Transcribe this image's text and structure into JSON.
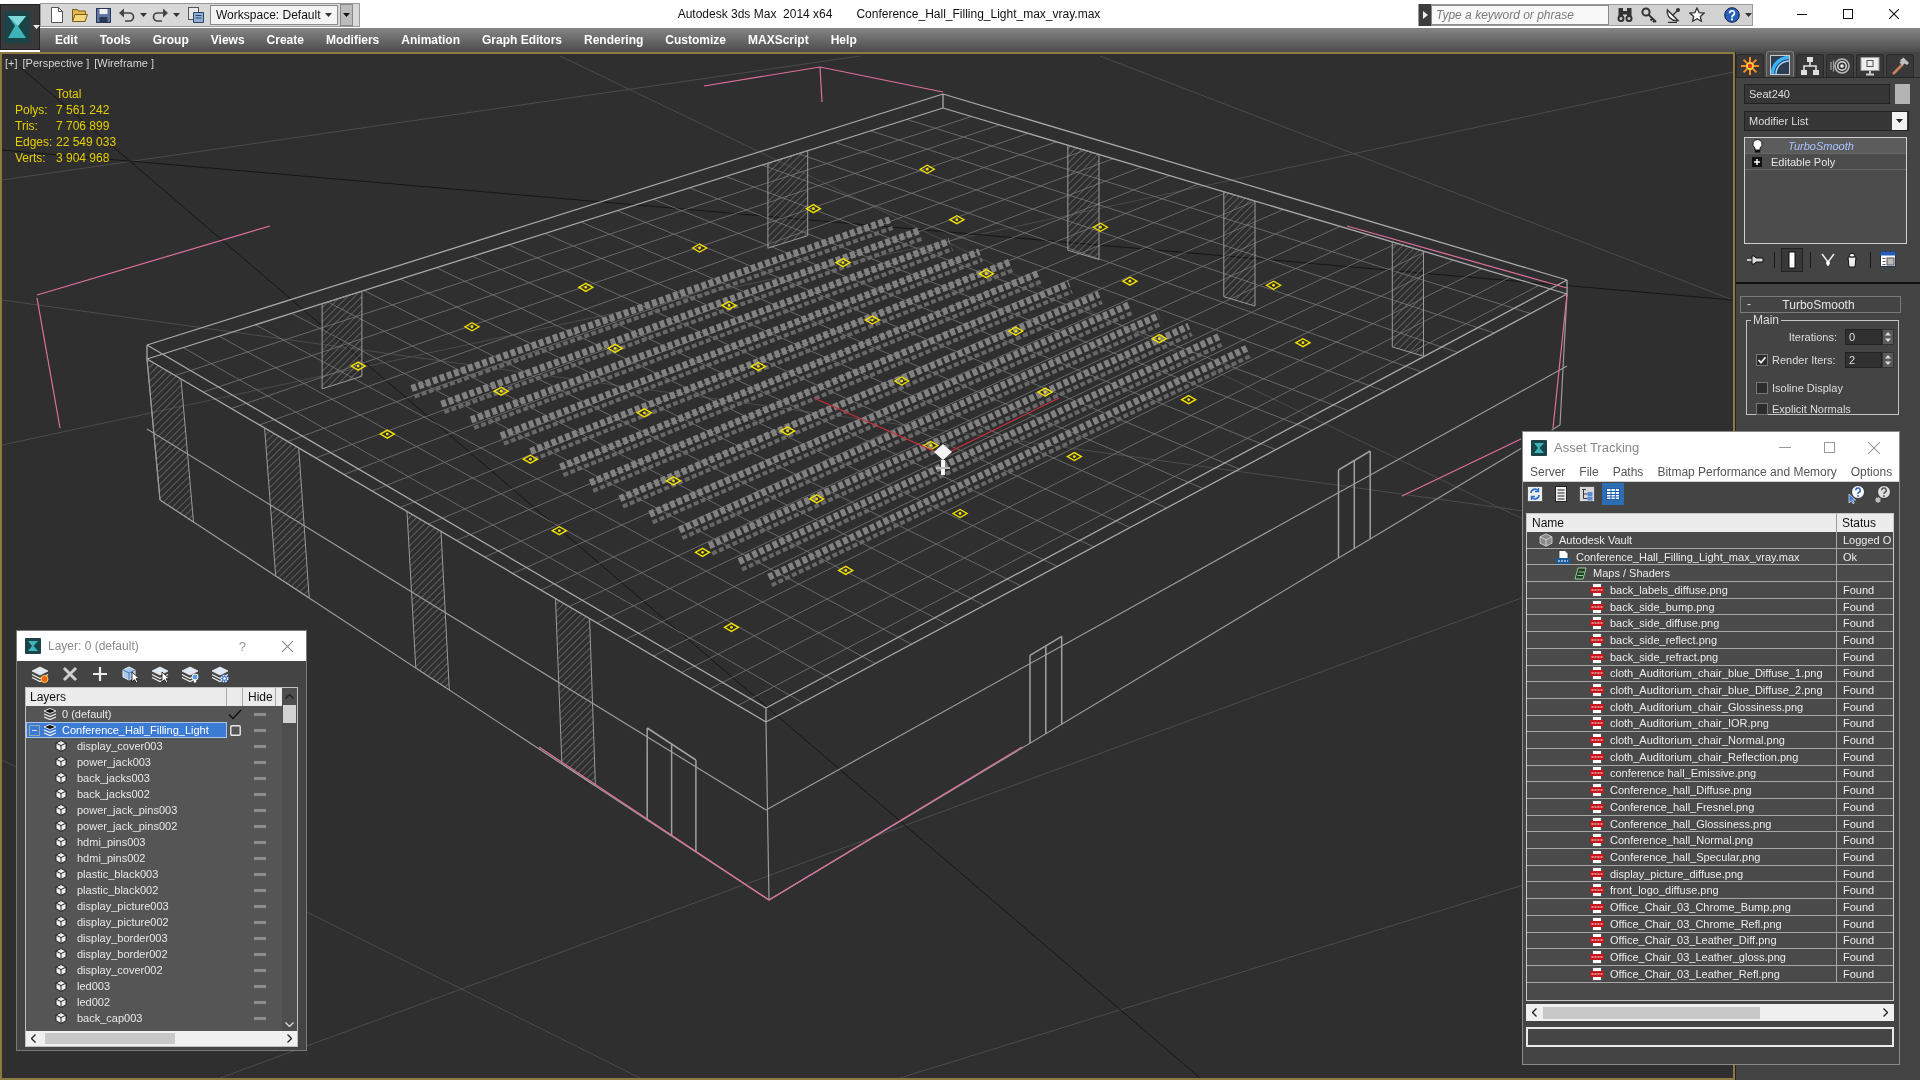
{
  "title_bar": {
    "workspace": "Workspace: Default",
    "app_title": "Autodesk 3ds Max  2014 x64",
    "document_title": "Conference_Hall_Filling_Light_max_vray.max",
    "search": {
      "placeholder": "Type a keyword or phrase"
    }
  },
  "menu_bar": [
    "Edit",
    "Tools",
    "Group",
    "Views",
    "Create",
    "Modifiers",
    "Animation",
    "Graph Editors",
    "Rendering",
    "Customize",
    "MAXScript",
    "Help"
  ],
  "viewport": {
    "labels": [
      "[+]",
      "[Perspective ]",
      "[Wireframe ]"
    ],
    "stats": {
      "heading": "Total",
      "rows": [
        {
          "label": "Polys:",
          "value": "7 561 242"
        },
        {
          "label": "Tris:",
          "value": "7 706 899"
        },
        {
          "label": "Edges:",
          "value": "22 549 033"
        },
        {
          "label": "Verts:",
          "value": "3 904 968"
        }
      ]
    }
  },
  "command_panel": {
    "tabs": [
      {
        "kind": "create",
        "selected": false
      },
      {
        "kind": "modify",
        "selected": true
      },
      {
        "kind": "hierarchy",
        "selected": false
      },
      {
        "kind": "motion",
        "selected": false
      },
      {
        "kind": "display",
        "selected": false
      },
      {
        "kind": "utilities",
        "selected": false
      }
    ],
    "object_name": "Seat240",
    "modifier_list": "Modifier List",
    "stack": [
      {
        "label": "TurboSmooth",
        "kind": "modifier",
        "selected": true
      },
      {
        "label": "Editable Poly",
        "kind": "object",
        "selected": false
      }
    ],
    "stack_tools": [
      {
        "kind": "pin",
        "pressed": false
      },
      {
        "kind": "end_result",
        "pressed": true
      },
      {
        "kind": "make_unique",
        "pressed": false
      },
      {
        "kind": "remove",
        "pressed": false
      },
      {
        "kind": "configure",
        "pressed": false
      }
    ],
    "rollout": {
      "toggle": "-",
      "title": "TurboSmooth",
      "group": "Main",
      "rows": [
        {
          "kind": "spinner",
          "label": "Iterations:",
          "value": "0"
        },
        {
          "kind": "check_spinner",
          "label": "Render Iters:",
          "value": "2",
          "checked": true
        },
        {
          "kind": "checkbox",
          "label": "Isoline Display",
          "checked": false
        },
        {
          "kind": "checkbox",
          "label": "Explicit Normals",
          "checked": false
        }
      ]
    }
  },
  "layer_window": {
    "title": "Layer: 0 (default)",
    "help": "?",
    "tools": [
      {
        "kind": "new_layer"
      },
      {
        "kind": "delete"
      },
      {
        "kind": "add"
      },
      {
        "kind": "select_objects"
      },
      {
        "kind": "select_layer"
      },
      {
        "kind": "highlight"
      },
      {
        "kind": "freeze"
      }
    ],
    "columns": [
      "Layers",
      "Hide"
    ],
    "layers": [
      {
        "name": "0 (default)",
        "current": true,
        "selected": false,
        "hidden": false
      },
      {
        "name": "Conference_Hall_Filling_Light",
        "current": false,
        "selected": true,
        "hidden": false,
        "expanded": true,
        "children": [
          {
            "name": "display_cover003",
            "selected": false,
            "hidden": false
          },
          {
            "name": "power_jack003",
            "selected": false,
            "hidden": false
          },
          {
            "name": "back_jacks003",
            "selected": false,
            "hidden": false
          },
          {
            "name": "back_jacks002",
            "selected": false,
            "hidden": false
          },
          {
            "name": "power_jack_pins003",
            "selected": false,
            "hidden": false
          },
          {
            "name": "power_jack_pins002",
            "selected": false,
            "hidden": false
          },
          {
            "name": "hdmi_pins003",
            "selected": false,
            "hidden": false
          },
          {
            "name": "hdmi_pins002",
            "selected": false,
            "hidden": false
          },
          {
            "name": "plastic_black003",
            "selected": false,
            "hidden": false
          },
          {
            "name": "plastic_black002",
            "selected": false,
            "hidden": false
          },
          {
            "name": "display_picture003",
            "selected": false,
            "hidden": false
          },
          {
            "name": "display_picture002",
            "selected": false,
            "hidden": false
          },
          {
            "name": "display_border003",
            "selected": false,
            "hidden": false
          },
          {
            "name": "display_border002",
            "selected": false,
            "hidden": false
          },
          {
            "name": "display_cover002",
            "selected": false,
            "hidden": false
          },
          {
            "name": "led003",
            "selected": false,
            "hidden": false
          },
          {
            "name": "led002",
            "selected": false,
            "hidden": false
          },
          {
            "name": "back_cap003",
            "selected": false,
            "hidden": false
          }
        ]
      }
    ]
  },
  "asset_tracking": {
    "title": "Asset Tracking",
    "menu": [
      "Server",
      "File",
      "Paths",
      "Bitmap Performance and Memory",
      "Options"
    ],
    "tools": [
      {
        "kind": "refresh",
        "pressed": false
      },
      {
        "kind": "list",
        "pressed": false
      },
      {
        "kind": "tree",
        "pressed": false
      },
      {
        "kind": "table",
        "pressed": true
      }
    ],
    "help_tools": [
      {
        "kind": "help"
      },
      {
        "kind": "help_options"
      }
    ],
    "columns": [
      "Name",
      "Status"
    ],
    "assets": [
      {
        "name": "Autodesk Vault",
        "status": "Logged O",
        "kind": "vault",
        "selected": false,
        "children": [
          {
            "name": "Conference_Hall_Filling_Light_max_vray.max",
            "status": "Ok",
            "kind": "max",
            "selected": false,
            "children": [
              {
                "name": "Maps / Shaders",
                "kind": "folder",
                "selected": false,
                "children": [
                  {
                    "name": "back_labels_diffuse.png",
                    "status": "Found",
                    "kind": "png",
                    "selected": false
                  },
                  {
                    "name": "back_side_bump.png",
                    "status": "Found",
                    "kind": "png",
                    "selected": false
                  },
                  {
                    "name": "back_side_diffuse.png",
                    "status": "Found",
                    "kind": "png",
                    "selected": false
                  },
                  {
                    "name": "back_side_reflect.png",
                    "status": "Found",
                    "kind": "png",
                    "selected": false
                  },
                  {
                    "name": "back_side_refract.png",
                    "status": "Found",
                    "kind": "png",
                    "selected": false
                  },
                  {
                    "name": "cloth_Auditorium_chair_blue_Diffuse_1.png",
                    "status": "Found",
                    "kind": "png",
                    "selected": false
                  },
                  {
                    "name": "cloth_Auditorium_chair_blue_Diffuse_2.png",
                    "status": "Found",
                    "kind": "png",
                    "selected": false
                  },
                  {
                    "name": "cloth_Auditorium_chair_Glossiness.png",
                    "status": "Found",
                    "kind": "png",
                    "selected": false
                  },
                  {
                    "name": "cloth_Auditorium_chair_IOR.png",
                    "status": "Found",
                    "kind": "png",
                    "selected": false
                  },
                  {
                    "name": "cloth_Auditorium_chair_Normal.png",
                    "status": "Found",
                    "kind": "png",
                    "selected": false
                  },
                  {
                    "name": "cloth_Auditorium_chair_Reflection.png",
                    "status": "Found",
                    "kind": "png",
                    "selected": false
                  },
                  {
                    "name": "conference hall_Emissive.png",
                    "status": "Found",
                    "kind": "png",
                    "selected": false
                  },
                  {
                    "name": "Conference_hall_Diffuse.png",
                    "status": "Found",
                    "kind": "png",
                    "selected": false
                  },
                  {
                    "name": "Conference_hall_Fresnel.png",
                    "status": "Found",
                    "kind": "png",
                    "selected": false
                  },
                  {
                    "name": "Conference_hall_Glossiness.png",
                    "status": "Found",
                    "kind": "png",
                    "selected": false
                  },
                  {
                    "name": "Conference_hall_Normal.png",
                    "status": "Found",
                    "kind": "png",
                    "selected": false
                  },
                  {
                    "name": "Conference_hall_Specular.png",
                    "status": "Found",
                    "kind": "png",
                    "selected": false
                  },
                  {
                    "name": "display_picture_diffuse.png",
                    "status": "Found",
                    "kind": "png",
                    "selected": false
                  },
                  {
                    "name": "front_logo_diffuse.png",
                    "status": "Found",
                    "kind": "png",
                    "selected": false
                  },
                  {
                    "name": "Office_Chair_03_Chrome_Bump.png",
                    "status": "Found",
                    "kind": "png",
                    "selected": false
                  },
                  {
                    "name": "Office_Chair_03_Chrome_Refl.png",
                    "status": "Found",
                    "kind": "png",
                    "selected": false
                  },
                  {
                    "name": "Office_Chair_03_Leather_Diff.png",
                    "status": "Found",
                    "kind": "png",
                    "selected": false
                  },
                  {
                    "name": "Office_Chair_03_Leather_gloss.png",
                    "status": "Found",
                    "kind": "png",
                    "selected": false
                  },
                  {
                    "name": "Office_Chair_03_Leather_Refl.png",
                    "status": "Found",
                    "kind": "png",
                    "selected": false
                  }
                ]
              }
            ]
          }
        ]
      }
    ]
  }
}
